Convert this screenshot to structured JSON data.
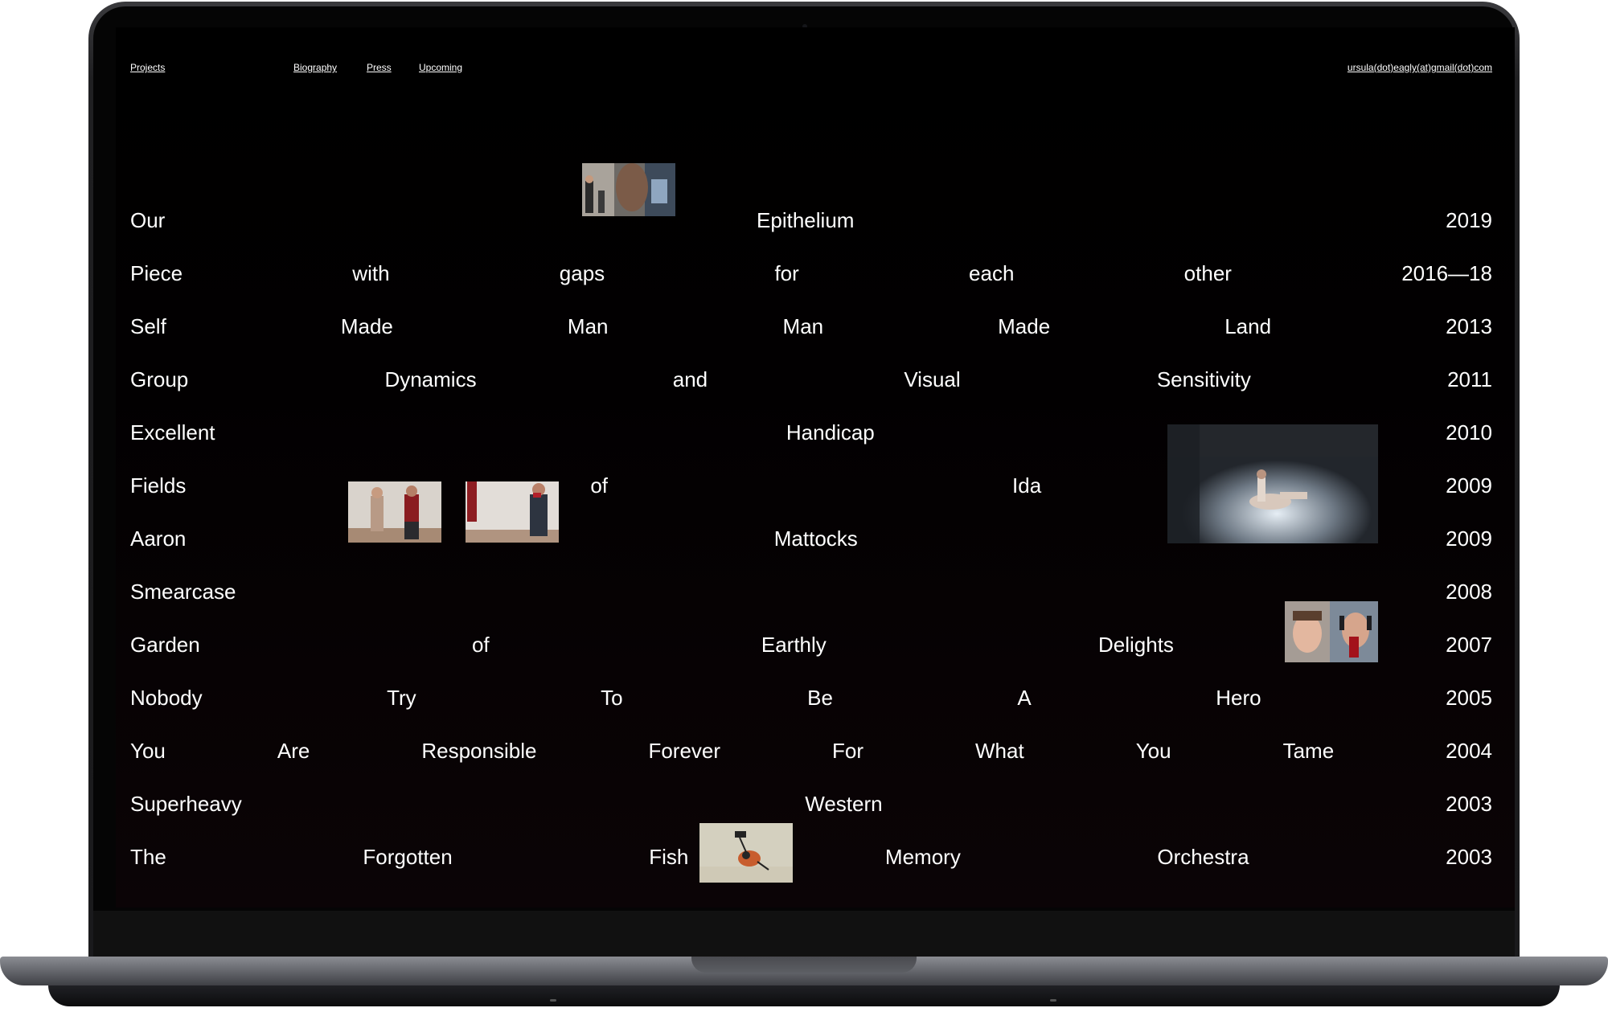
{
  "nav": {
    "projects": "Projects",
    "biography": "Biography",
    "press": "Press",
    "upcoming": "Upcoming",
    "email": "ursula(dot)eagly(at)gmail(dot)com"
  },
  "projects": [
    {
      "words": [
        "Our",
        "Epithelium"
      ],
      "year": "2019"
    },
    {
      "words": [
        "Piece",
        "with",
        "gaps",
        "for",
        "each",
        "other"
      ],
      "year": "2016—18"
    },
    {
      "words": [
        "Self",
        "Made",
        "Man",
        "Man",
        "Made",
        "Land"
      ],
      "year": "2013"
    },
    {
      "words": [
        "Group",
        "Dynamics",
        "and",
        "Visual",
        "Sensitivity"
      ],
      "year": "2011"
    },
    {
      "words": [
        "Excellent",
        "Handicap"
      ],
      "year": "2010"
    },
    {
      "words": [
        "Fields",
        "of",
        "Ida"
      ],
      "year": "2009"
    },
    {
      "words": [
        "Aaron",
        "Mattocks"
      ],
      "year": "2009"
    },
    {
      "words": [
        "Smearcase"
      ],
      "year": "2008"
    },
    {
      "words": [
        "Garden",
        "of",
        "Earthly",
        "Delights"
      ],
      "year": "2007"
    },
    {
      "words": [
        "Nobody",
        "Try",
        "To",
        "Be",
        "A",
        "Hero"
      ],
      "year": "2005"
    },
    {
      "words": [
        "You",
        "Are",
        "Responsible",
        "Forever",
        "For",
        "What",
        "You",
        "Tame"
      ],
      "year": "2004"
    },
    {
      "words": [
        "Superheavy",
        "Western"
      ],
      "year": "2003"
    },
    {
      "words": [
        "The",
        "Forgotten",
        "Fish",
        "Memory",
        "Orchestra"
      ],
      "year": "2003"
    }
  ],
  "thumbnails": [
    {
      "name": "thumb-our-epithelium"
    },
    {
      "name": "thumb-aaron-1"
    },
    {
      "name": "thumb-aaron-2"
    },
    {
      "name": "thumb-fields-of-ida"
    },
    {
      "name": "thumb-garden-of-earthly-delights"
    },
    {
      "name": "thumb-forgotten-fish"
    }
  ]
}
